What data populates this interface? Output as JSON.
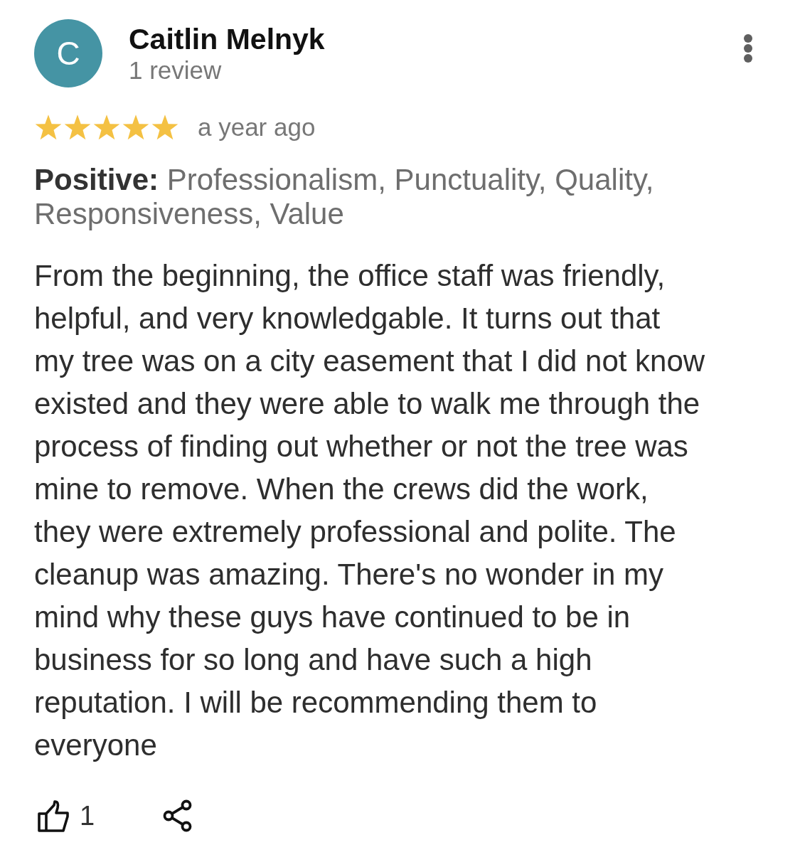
{
  "reviewer": {
    "initial": "C",
    "name": "Caitlin Melnyk",
    "review_count": "1 review"
  },
  "review": {
    "stars": 5,
    "time": "a year ago",
    "positive": "**Positive:** Professionalism, Punctuality, Quality, Responsiveness, Value",
    "text": "From the beginning, the office staff was friendly, helpful, and very knowledgable. It turns out that my tree was on a city easement that I did not know existed and they were able to walk me through the process of finding out whether or not the tree was mine to remove. When the crews did the work, they were extremely professional and polite. The cleanup was amazing. There's no wonder in my mind why these guys have continued to be in business for so long and have such a high reputation. I will be recommending them to everyone"
  },
  "actions": {
    "like_count": "1"
  }
}
